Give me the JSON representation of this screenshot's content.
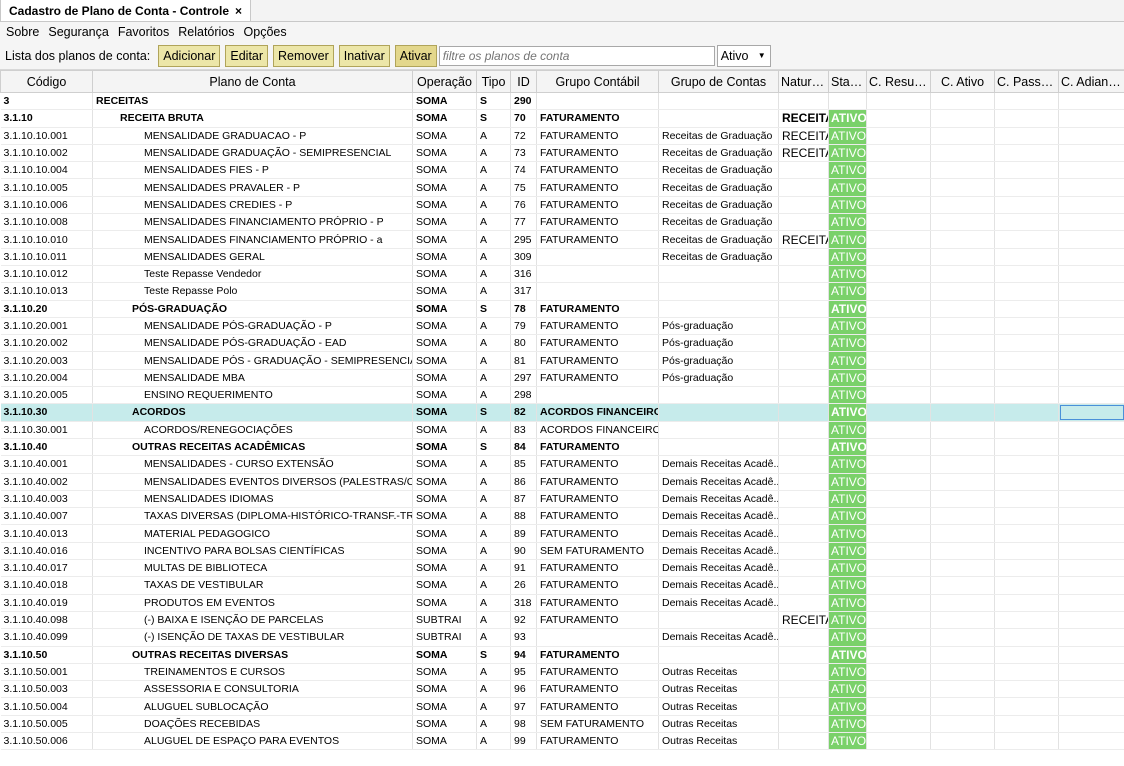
{
  "window": {
    "tab_title": "Cadastro de Plano de Conta - Controle",
    "close_glyph": "×"
  },
  "menu": [
    "Sobre",
    "Segurança",
    "Favoritos",
    "Relatórios",
    "Opções"
  ],
  "toolbar": {
    "label": "Lista dos planos de conta:",
    "add": "Adicionar",
    "edit": "Editar",
    "remove": "Remover",
    "inactivate": "Inativar",
    "activate": "Ativar",
    "filter_placeholder": "filtre os planos de conta",
    "status_select": "Ativo"
  },
  "columns": [
    "Código",
    "Plano de Conta",
    "Operação",
    "Tipo",
    "ID",
    "Grupo Contábil",
    "Grupo de Contas",
    "Nature...",
    "Status",
    "C. Resulta...",
    "C. Ativo",
    "C. Passivo",
    "C. Adianta..."
  ],
  "colors": {
    "status_green": "#7ad16a",
    "highlight_row": "#c6ebeb",
    "button_bg": "#ece6a8"
  },
  "rows": [
    {
      "code": "3",
      "plan": "RECEITAS",
      "op": "SOMA",
      "tipo": "S",
      "id": "290",
      "gc": "",
      "gcontas": "",
      "nat": "",
      "status": "",
      "bold": true,
      "lvl": 0
    },
    {
      "code": "3.1.10",
      "plan": "RECEITA BRUTA",
      "op": "SOMA",
      "tipo": "S",
      "id": "70",
      "gc": "FATURAMENTO",
      "gcontas": "",
      "nat": "RECEITA",
      "status": "ATIVO",
      "bold": true,
      "lvl": 1
    },
    {
      "code": "3.1.10.10.001",
      "plan": "MENSALIDADE GRADUACAO - P",
      "op": "SOMA",
      "tipo": "A",
      "id": "72",
      "gc": "FATURAMENTO",
      "gcontas": "Receitas de Graduação",
      "nat": "RECEITA",
      "status": "ATIVO",
      "lvl": 3
    },
    {
      "code": "3.1.10.10.002",
      "plan": "MENSALIDADE GRADUAÇÃO - SEMIPRESENCIAL",
      "op": "SOMA",
      "tipo": "A",
      "id": "73",
      "gc": "FATURAMENTO",
      "gcontas": "Receitas de Graduação",
      "nat": "RECEITA",
      "status": "ATIVO",
      "lvl": 3
    },
    {
      "code": "3.1.10.10.004",
      "plan": "MENSALIDADES FIES - P",
      "op": "SOMA",
      "tipo": "A",
      "id": "74",
      "gc": "FATURAMENTO",
      "gcontas": "Receitas de Graduação",
      "nat": "",
      "status": "ATIVO",
      "lvl": 3
    },
    {
      "code": "3.1.10.10.005",
      "plan": "MENSALIDADES PRAVALER - P",
      "op": "SOMA",
      "tipo": "A",
      "id": "75",
      "gc": "FATURAMENTO",
      "gcontas": "Receitas de Graduação",
      "nat": "",
      "status": "ATIVO",
      "lvl": 3
    },
    {
      "code": "3.1.10.10.006",
      "plan": "MENSALIDADES CREDIES - P",
      "op": "SOMA",
      "tipo": "A",
      "id": "76",
      "gc": "FATURAMENTO",
      "gcontas": "Receitas de Graduação",
      "nat": "",
      "status": "ATIVO",
      "lvl": 3
    },
    {
      "code": "3.1.10.10.008",
      "plan": "MENSALIDADES FINANCIAMENTO PRÓPRIO - P",
      "op": "SOMA",
      "tipo": "A",
      "id": "77",
      "gc": "FATURAMENTO",
      "gcontas": "Receitas de Graduação",
      "nat": "",
      "status": "ATIVO",
      "lvl": 3
    },
    {
      "code": "3.1.10.10.010",
      "plan": "MENSALIDADES FINANCIAMENTO PRÓPRIO - a",
      "op": "SOMA",
      "tipo": "A",
      "id": "295",
      "gc": "FATURAMENTO",
      "gcontas": "Receitas de Graduação",
      "nat": "RECEITA",
      "status": "ATIVO",
      "lvl": 3
    },
    {
      "code": "3.1.10.10.011",
      "plan": "MENSALIDADES GERAL",
      "op": "SOMA",
      "tipo": "A",
      "id": "309",
      "gc": "",
      "gcontas": "Receitas de Graduação",
      "nat": "",
      "status": "ATIVO",
      "lvl": 3
    },
    {
      "code": "3.1.10.10.012",
      "plan": "Teste Repasse Vendedor",
      "op": "SOMA",
      "tipo": "A",
      "id": "316",
      "gc": "",
      "gcontas": "",
      "nat": "",
      "status": "ATIVO",
      "lvl": 3
    },
    {
      "code": "3.1.10.10.013",
      "plan": "Teste Repasse Polo",
      "op": "SOMA",
      "tipo": "A",
      "id": "317",
      "gc": "",
      "gcontas": "",
      "nat": "",
      "status": "ATIVO",
      "lvl": 3
    },
    {
      "code": "3.1.10.20",
      "plan": "PÓS-GRADUAÇÃO",
      "op": "SOMA",
      "tipo": "S",
      "id": "78",
      "gc": "FATURAMENTO",
      "gcontas": "",
      "nat": "",
      "status": "ATIVO",
      "bold": true,
      "lvl": 2
    },
    {
      "code": "3.1.10.20.001",
      "plan": "MENSALIDADE PÓS-GRADUAÇÃO - P",
      "op": "SOMA",
      "tipo": "A",
      "id": "79",
      "gc": "FATURAMENTO",
      "gcontas": "Pós-graduação",
      "nat": "",
      "status": "ATIVO",
      "lvl": 3
    },
    {
      "code": "3.1.10.20.002",
      "plan": "MENSALIDADE PÓS-GRADUAÇÃO - EAD",
      "op": "SOMA",
      "tipo": "A",
      "id": "80",
      "gc": "FATURAMENTO",
      "gcontas": "Pós-graduação",
      "nat": "",
      "status": "ATIVO",
      "lvl": 3
    },
    {
      "code": "3.1.10.20.003",
      "plan": "MENSALIDADE PÓS - GRADUAÇÃO - SEMIPRESENCIAL",
      "op": "SOMA",
      "tipo": "A",
      "id": "81",
      "gc": "FATURAMENTO",
      "gcontas": "Pós-graduação",
      "nat": "",
      "status": "ATIVO",
      "lvl": 3
    },
    {
      "code": "3.1.10.20.004",
      "plan": "MENSALIDADE MBA",
      "op": "SOMA",
      "tipo": "A",
      "id": "297",
      "gc": "FATURAMENTO",
      "gcontas": "Pós-graduação",
      "nat": "",
      "status": "ATIVO",
      "lvl": 3
    },
    {
      "code": "3.1.10.20.005",
      "plan": "ENSINO REQUERIMENTO",
      "op": "SOMA",
      "tipo": "A",
      "id": "298",
      "gc": "",
      "gcontas": "",
      "nat": "",
      "status": "ATIVO",
      "lvl": 3
    },
    {
      "code": "3.1.10.30",
      "plan": "ACORDOS",
      "op": "SOMA",
      "tipo": "S",
      "id": "82",
      "gc": "ACORDOS FINANCEIROS",
      "gcontas": "",
      "nat": "",
      "status": "ATIVO",
      "bold": true,
      "hl": true,
      "lvl": 2
    },
    {
      "code": "3.1.10.30.001",
      "plan": "ACORDOS/RENEGOCIAÇÕES",
      "op": "SOMA",
      "tipo": "A",
      "id": "83",
      "gc": "ACORDOS FINANCEIROS",
      "gcontas": "",
      "nat": "",
      "status": "ATIVO",
      "lvl": 3
    },
    {
      "code": "3.1.10.40",
      "plan": "OUTRAS RECEITAS ACADÊMICAS",
      "op": "SOMA",
      "tipo": "S",
      "id": "84",
      "gc": "FATURAMENTO",
      "gcontas": "",
      "nat": "",
      "status": "ATIVO",
      "bold": true,
      "lvl": 2
    },
    {
      "code": "3.1.10.40.001",
      "plan": "MENSALIDADES - CURSO EXTENSÃO",
      "op": "SOMA",
      "tipo": "A",
      "id": "85",
      "gc": "FATURAMENTO",
      "gcontas": "Demais Receitas Acadê...",
      "nat": "",
      "status": "ATIVO",
      "lvl": 3
    },
    {
      "code": "3.1.10.40.002",
      "plan": "MENSALIDADES EVENTOS DIVERSOS (PALESTRAS/CONGRESSOS)",
      "op": "SOMA",
      "tipo": "A",
      "id": "86",
      "gc": "FATURAMENTO",
      "gcontas": "Demais Receitas Acadê...",
      "nat": "",
      "status": "ATIVO",
      "lvl": 3
    },
    {
      "code": "3.1.10.40.003",
      "plan": "MENSALIDADES IDIOMAS",
      "op": "SOMA",
      "tipo": "A",
      "id": "87",
      "gc": "FATURAMENTO",
      "gcontas": "Demais Receitas Acadê...",
      "nat": "",
      "status": "ATIVO",
      "lvl": 3
    },
    {
      "code": "3.1.10.40.007",
      "plan": "TAXAS DIVERSAS (DIPLOMA-HISTÓRICO-TRANSF.-TRANCAMENTO)",
      "op": "SOMA",
      "tipo": "A",
      "id": "88",
      "gc": "FATURAMENTO",
      "gcontas": "Demais Receitas Acadê...",
      "nat": "",
      "status": "ATIVO",
      "lvl": 3
    },
    {
      "code": "3.1.10.40.013",
      "plan": "MATERIAL PEDAGOGICO",
      "op": "SOMA",
      "tipo": "A",
      "id": "89",
      "gc": "FATURAMENTO",
      "gcontas": "Demais Receitas Acadê...",
      "nat": "",
      "status": "ATIVO",
      "lvl": 3
    },
    {
      "code": "3.1.10.40.016",
      "plan": "INCENTIVO PARA BOLSAS CIENTÍFICAS",
      "op": "SOMA",
      "tipo": "A",
      "id": "90",
      "gc": "SEM FATURAMENTO",
      "gcontas": "Demais Receitas Acadê...",
      "nat": "",
      "status": "ATIVO",
      "lvl": 3
    },
    {
      "code": "3.1.10.40.017",
      "plan": "MULTAS DE BIBLIOTECA",
      "op": "SOMA",
      "tipo": "A",
      "id": "91",
      "gc": "FATURAMENTO",
      "gcontas": "Demais Receitas Acadê...",
      "nat": "",
      "status": "ATIVO",
      "lvl": 3
    },
    {
      "code": "3.1.10.40.018",
      "plan": "TAXAS DE VESTIBULAR",
      "op": "SOMA",
      "tipo": "A",
      "id": "26",
      "gc": "FATURAMENTO",
      "gcontas": "Demais Receitas Acadê...",
      "nat": "",
      "status": "ATIVO",
      "lvl": 3
    },
    {
      "code": "3.1.10.40.019",
      "plan": "PRODUTOS EM EVENTOS",
      "op": "SOMA",
      "tipo": "A",
      "id": "318",
      "gc": "FATURAMENTO",
      "gcontas": "Demais Receitas Acadê...",
      "nat": "",
      "status": "ATIVO",
      "lvl": 3
    },
    {
      "code": "3.1.10.40.098",
      "plan": "(-) BAIXA E ISENÇÃO DE PARCELAS",
      "op": "SUBTRAI",
      "tipo": "A",
      "id": "92",
      "gc": "FATURAMENTO",
      "gcontas": "",
      "nat": "RECEITA",
      "status": "ATIVO",
      "lvl": 3
    },
    {
      "code": "3.1.10.40.099",
      "plan": "(-) ISENÇÃO DE TAXAS DE VESTIBULAR",
      "op": "SUBTRAI",
      "tipo": "A",
      "id": "93",
      "gc": "",
      "gcontas": "Demais Receitas Acadê...",
      "nat": "",
      "status": "ATIVO",
      "lvl": 3
    },
    {
      "code": "3.1.10.50",
      "plan": "OUTRAS RECEITAS DIVERSAS",
      "op": "SOMA",
      "tipo": "S",
      "id": "94",
      "gc": "FATURAMENTO",
      "gcontas": "",
      "nat": "",
      "status": "ATIVO",
      "bold": true,
      "lvl": 2
    },
    {
      "code": "3.1.10.50.001",
      "plan": "TREINAMENTOS E CURSOS",
      "op": "SOMA",
      "tipo": "A",
      "id": "95",
      "gc": "FATURAMENTO",
      "gcontas": "Outras Receitas",
      "nat": "",
      "status": "ATIVO",
      "lvl": 3
    },
    {
      "code": "3.1.10.50.003",
      "plan": "ASSESSORIA E CONSULTORIA",
      "op": "SOMA",
      "tipo": "A",
      "id": "96",
      "gc": "FATURAMENTO",
      "gcontas": "Outras Receitas",
      "nat": "",
      "status": "ATIVO",
      "lvl": 3
    },
    {
      "code": "3.1.10.50.004",
      "plan": "ALUGUEL SUBLOCAÇÃO",
      "op": "SOMA",
      "tipo": "A",
      "id": "97",
      "gc": "FATURAMENTO",
      "gcontas": "Outras Receitas",
      "nat": "",
      "status": "ATIVO",
      "lvl": 3
    },
    {
      "code": "3.1.10.50.005",
      "plan": "DOAÇÕES RECEBIDAS",
      "op": "SOMA",
      "tipo": "A",
      "id": "98",
      "gc": "SEM FATURAMENTO",
      "gcontas": "Outras Receitas",
      "nat": "",
      "status": "ATIVO",
      "lvl": 3
    },
    {
      "code": "3.1.10.50.006",
      "plan": "ALUGUEL DE ESPAÇO PARA EVENTOS",
      "op": "SOMA",
      "tipo": "A",
      "id": "99",
      "gc": "FATURAMENTO",
      "gcontas": "Outras Receitas",
      "nat": "",
      "status": "ATIVO",
      "lvl": 3
    }
  ]
}
